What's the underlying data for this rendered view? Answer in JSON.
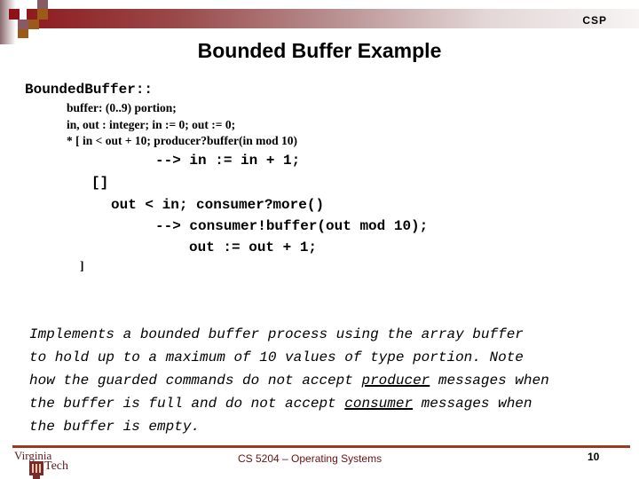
{
  "header": {
    "section_label": "CSP",
    "colors": {
      "bar_start": "#8e1b1e",
      "bar_end": "#f7f4f4",
      "accent_orange": "#9b5a1a"
    }
  },
  "slide": {
    "title": "Bounded Buffer Example",
    "code": {
      "head": "BoundedBuffer::",
      "decl_lines": [
        "buffer: (0..9) portion;",
        "in, out : integer; in := 0; out := 0;",
        "* [ in < out + 10; producer?buffer(in mod 10)"
      ],
      "body_lines": [
        "--> in := in + 1;",
        "[]",
        "out < in; consumer?more()",
        "--> consumer!buffer(out mod 10);",
        "out := out + 1;",
        "]"
      ]
    },
    "description": {
      "line1": "Implements a bounded buffer process using the array buffer",
      "line2": "to hold up to a maximum of 10 values of type portion. Note",
      "line3_pre": "how the guarded commands do not accept ",
      "line3_ul": "producer",
      "line3_post": " messages when",
      "line4_pre": "the buffer is full and do not accept ",
      "line4_ul": "consumer",
      "line4_post": " messages when",
      "line5": "the buffer is empty."
    }
  },
  "footer": {
    "logo_word1": "Virginia",
    "logo_word2": "Tech",
    "course": "CS 5204 – Operating Systems",
    "page_number": "10",
    "rule_color": "#9b3a22"
  }
}
